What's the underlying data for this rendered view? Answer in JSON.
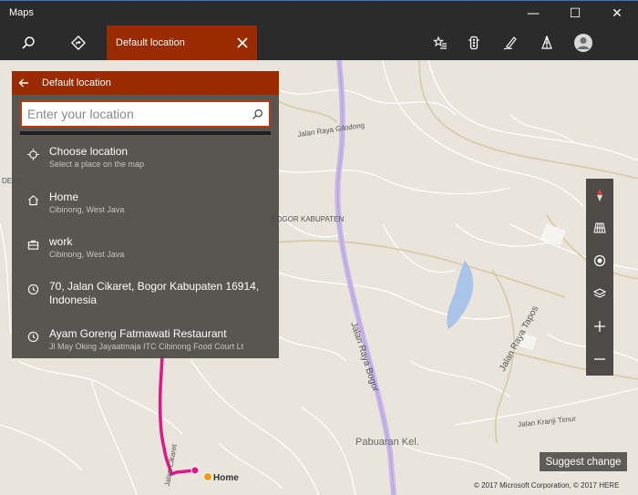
{
  "window": {
    "title": "Maps",
    "minimize_glyph": "—",
    "maximize_glyph": "☐",
    "close_glyph": "✕"
  },
  "toolbar": {
    "active_tab_label": "Default location",
    "icons": [
      "search-icon",
      "directions-icon",
      "favorites-icon",
      "traffic-icon",
      "ink-icon",
      "3d-cities-icon",
      "account-icon"
    ]
  },
  "panel": {
    "header_title": "Default location",
    "search_placeholder": "Enter your location",
    "items": [
      {
        "icon": "target-icon",
        "title": "Choose location",
        "subtitle": "Select a place on the map"
      },
      {
        "icon": "home-icon",
        "title": "Home",
        "subtitle": "Cibinong, West Java"
      },
      {
        "icon": "briefcase-icon",
        "title": "work",
        "subtitle": "Cibinong, West Java"
      },
      {
        "icon": "history-icon",
        "title": "70, Jalan Cikaret, Bogor Kabupaten 16914, Indonesia",
        "subtitle": ""
      },
      {
        "icon": "history-icon",
        "title": "Ayam Goreng Fatmawati Restaurant",
        "subtitle": "Jl May Oking Jayaatmaja ITC Cibinong Food Court Lt"
      }
    ]
  },
  "map": {
    "labels": {
      "gilodong": "Jalan Raya Gilodong",
      "bogor_kab": "BOGOR KABUPATEN",
      "raya_bogor": "Jalan Raya Bogor",
      "tapos": "Jalan Raya Tapos",
      "pabuaran": "Pabuaran Kel.",
      "kranji": "Jalan Kranji Timur",
      "cikaret": "Jalan Cikaret",
      "depok": "DEPO"
    },
    "home_pin_label": "Home",
    "suggest_change": "Suggest change",
    "copyright": "© 2017 Microsoft Corporation, © 2017 HERE",
    "colors": {
      "accent": "#9a2a00",
      "route": "#e0168a",
      "highway": "#c9b6e8",
      "water": "#a8c4e8"
    }
  }
}
